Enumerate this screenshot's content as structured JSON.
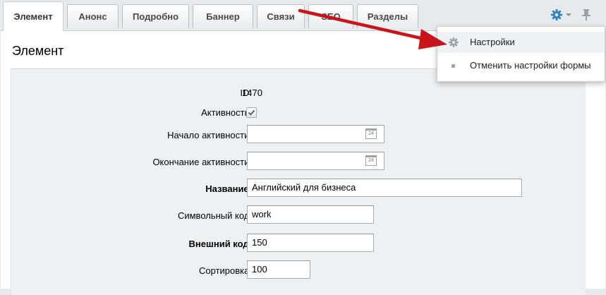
{
  "tabs": [
    {
      "label": "Элемент"
    },
    {
      "label": "Анонс"
    },
    {
      "label": "Подробно"
    },
    {
      "label": "Баннер"
    },
    {
      "label": "Связи"
    },
    {
      "label": "SEO"
    },
    {
      "label": "Разделы"
    }
  ],
  "panel": {
    "title": "Элемент"
  },
  "form": {
    "id_label": "ID:",
    "id_value": "1470",
    "active_label": "Активность:",
    "active_checked": true,
    "start_label": "Начало активности:",
    "start_value": "",
    "end_label": "Окончание активности:",
    "end_value": "",
    "calendar_day": "24",
    "name_label": "Название:",
    "name_value": "Английский для бизнеса",
    "code_label": "Символьный код:",
    "code_value": "work",
    "xml_label": "Внешний код:",
    "xml_value": "150",
    "sort_label": "Сортировка:",
    "sort_value": "100"
  },
  "menu": {
    "items": [
      {
        "label": "Настройки",
        "icon": "gear-icon"
      },
      {
        "label": "Отменить настройки формы",
        "icon": "bullet-icon"
      }
    ]
  },
  "toolbar": {
    "gear_icon": "gear-icon",
    "pin_icon": "pin-icon"
  },
  "colors": {
    "accent_blue": "#2f7fc1",
    "arrow_red": "#c8141a",
    "panel_bg": "#eef1f3"
  }
}
